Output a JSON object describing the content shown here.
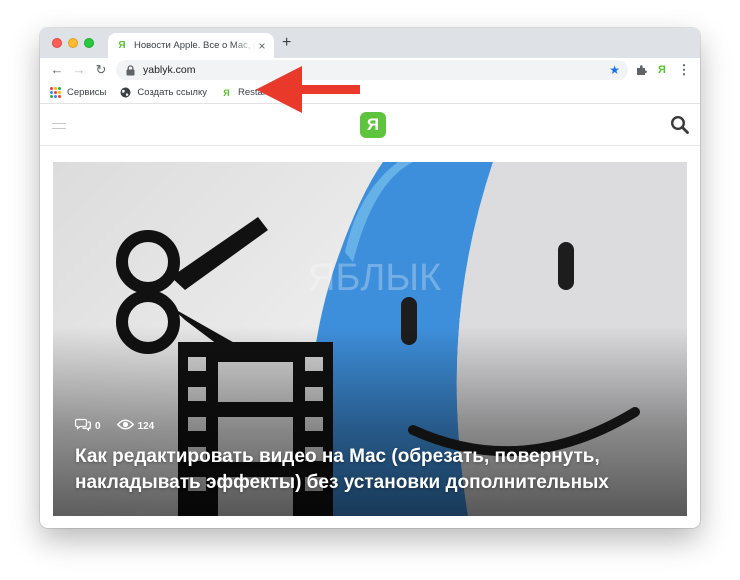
{
  "colors": {
    "close": "#fe5f57",
    "minimize": "#febc2e",
    "zoom": "#28c840",
    "accent_blue": "#1a73e8",
    "yablyk_green": "#5ec43d",
    "annotation_red": "#e8392b"
  },
  "tab": {
    "favicon": "Я",
    "title": "Новости Apple. Все о Mac, iPhone, iPad",
    "close_glyph": "×",
    "new_tab_glyph": "+"
  },
  "toolbar": {
    "back_glyph": "←",
    "forward_glyph": "→",
    "reload_glyph": "↻",
    "url": "yablyk.com",
    "star_glyph": "★",
    "extensions_icon": "puzzle-icon",
    "ya_extension": "Я",
    "menu_glyph": "⋮"
  },
  "bookmarks": [
    {
      "label": "Сервисы",
      "icon": "apps-grid-icon"
    },
    {
      "label": "Создать ссылку",
      "icon": "globe-icon"
    },
    {
      "label": "Restart",
      "icon": "Я"
    }
  ],
  "site": {
    "logo": "Я",
    "watermark": "ЯБЛЫК"
  },
  "article": {
    "comments": "0",
    "views": "124",
    "title": "Как редактировать видео на Mac (обрезать, повернуть, накладывать эффекты) без установки дополнительных"
  }
}
